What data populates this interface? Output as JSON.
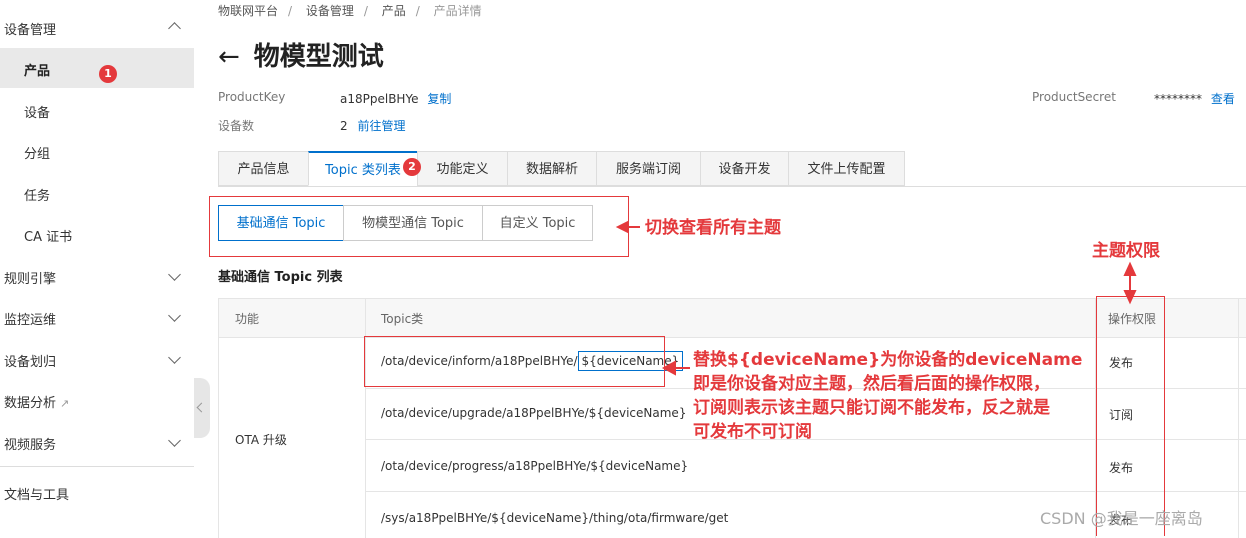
{
  "sidebar": {
    "groups": [
      {
        "label": "设备管理",
        "expanded": true
      },
      {
        "label": "规则引擎"
      },
      {
        "label": "监控运维"
      },
      {
        "label": "设备划归"
      },
      {
        "label": "数据分析"
      },
      {
        "label": "视频服务"
      },
      {
        "label": "文档与工具"
      }
    ],
    "items": [
      {
        "label": "产品",
        "active": true
      },
      {
        "label": "设备"
      },
      {
        "label": "分组"
      },
      {
        "label": "任务"
      },
      {
        "label": "CA 证书"
      }
    ]
  },
  "badges": {
    "one": "1",
    "two": "2"
  },
  "breadcrumb": [
    "物联网平台",
    "设备管理",
    "产品",
    "产品详情"
  ],
  "page_title": "物模型测试",
  "meta": {
    "product_key_label": "ProductKey",
    "product_key_value": "a18PpelBHYe",
    "copy_label": "复制",
    "device_count_label": "设备数",
    "device_count_value": "2",
    "manage_label": "前往管理",
    "product_secret_label": "ProductSecret",
    "product_secret_value": "********",
    "view_label": "查看"
  },
  "tabs": [
    "产品信息",
    "Topic 类列表",
    "功能定义",
    "数据解析",
    "服务端订阅",
    "设备开发",
    "文件上传配置"
  ],
  "subtabs": [
    "基础通信 Topic",
    "物模型通信 Topic",
    "自定义 Topic"
  ],
  "section_title": "基础通信 Topic 列表",
  "table": {
    "headers": {
      "func": "功能",
      "topic": "Topic类",
      "perm": "操作权限"
    },
    "group_label": "OTA 升级",
    "rows": [
      {
        "prefix": "/ota/device/inform/a18PpelBHYe/",
        "var": "${deviceName}",
        "perm": "发布"
      },
      {
        "topic": "/ota/device/upgrade/a18PpelBHYe/${deviceName}",
        "perm": "订阅"
      },
      {
        "topic": "/ota/device/progress/a18PpelBHYe/${deviceName}",
        "perm": "发布"
      },
      {
        "topic": "/sys/a18PpelBHYe/${deviceName}/thing/ota/firmware/get",
        "perm": "发布"
      }
    ]
  },
  "annotations": {
    "switch_note": "切换查看所有主题",
    "perm_note": "主题权限",
    "replace_note": [
      "替换${deviceName}为你设备的deviceName",
      "即是你设备对应主题，然后看后面的操作权限，",
      "订阅则表示该主题只能订阅不能发布，反之就是",
      "可发布不可订阅"
    ]
  },
  "watermark": "CSDN @我是一座离岛",
  "colors": {
    "accent": "#0070cc",
    "annotation": "#e4393c"
  }
}
